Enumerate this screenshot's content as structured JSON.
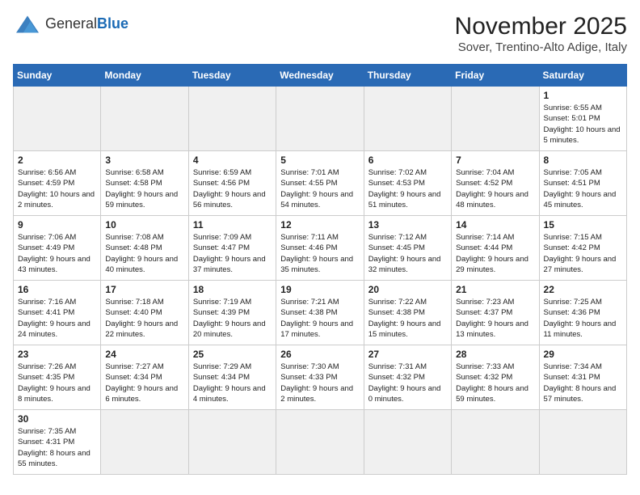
{
  "logo": {
    "text_general": "General",
    "text_blue": "Blue"
  },
  "title": "November 2025",
  "subtitle": "Sover, Trentino-Alto Adige, Italy",
  "days_of_week": [
    "Sunday",
    "Monday",
    "Tuesday",
    "Wednesday",
    "Thursday",
    "Friday",
    "Saturday"
  ],
  "weeks": [
    [
      {
        "day": "",
        "info": "",
        "empty": true
      },
      {
        "day": "",
        "info": "",
        "empty": true
      },
      {
        "day": "",
        "info": "",
        "empty": true
      },
      {
        "day": "",
        "info": "",
        "empty": true
      },
      {
        "day": "",
        "info": "",
        "empty": true
      },
      {
        "day": "",
        "info": "",
        "empty": true
      },
      {
        "day": "1",
        "info": "Sunrise: 6:55 AM\nSunset: 5:01 PM\nDaylight: 10 hours and 5 minutes."
      }
    ],
    [
      {
        "day": "2",
        "info": "Sunrise: 6:56 AM\nSunset: 4:59 PM\nDaylight: 10 hours and 2 minutes."
      },
      {
        "day": "3",
        "info": "Sunrise: 6:58 AM\nSunset: 4:58 PM\nDaylight: 9 hours and 59 minutes."
      },
      {
        "day": "4",
        "info": "Sunrise: 6:59 AM\nSunset: 4:56 PM\nDaylight: 9 hours and 56 minutes."
      },
      {
        "day": "5",
        "info": "Sunrise: 7:01 AM\nSunset: 4:55 PM\nDaylight: 9 hours and 54 minutes."
      },
      {
        "day": "6",
        "info": "Sunrise: 7:02 AM\nSunset: 4:53 PM\nDaylight: 9 hours and 51 minutes."
      },
      {
        "day": "7",
        "info": "Sunrise: 7:04 AM\nSunset: 4:52 PM\nDaylight: 9 hours and 48 minutes."
      },
      {
        "day": "8",
        "info": "Sunrise: 7:05 AM\nSunset: 4:51 PM\nDaylight: 9 hours and 45 minutes."
      }
    ],
    [
      {
        "day": "9",
        "info": "Sunrise: 7:06 AM\nSunset: 4:49 PM\nDaylight: 9 hours and 43 minutes."
      },
      {
        "day": "10",
        "info": "Sunrise: 7:08 AM\nSunset: 4:48 PM\nDaylight: 9 hours and 40 minutes."
      },
      {
        "day": "11",
        "info": "Sunrise: 7:09 AM\nSunset: 4:47 PM\nDaylight: 9 hours and 37 minutes."
      },
      {
        "day": "12",
        "info": "Sunrise: 7:11 AM\nSunset: 4:46 PM\nDaylight: 9 hours and 35 minutes."
      },
      {
        "day": "13",
        "info": "Sunrise: 7:12 AM\nSunset: 4:45 PM\nDaylight: 9 hours and 32 minutes."
      },
      {
        "day": "14",
        "info": "Sunrise: 7:14 AM\nSunset: 4:44 PM\nDaylight: 9 hours and 29 minutes."
      },
      {
        "day": "15",
        "info": "Sunrise: 7:15 AM\nSunset: 4:42 PM\nDaylight: 9 hours and 27 minutes."
      }
    ],
    [
      {
        "day": "16",
        "info": "Sunrise: 7:16 AM\nSunset: 4:41 PM\nDaylight: 9 hours and 24 minutes."
      },
      {
        "day": "17",
        "info": "Sunrise: 7:18 AM\nSunset: 4:40 PM\nDaylight: 9 hours and 22 minutes."
      },
      {
        "day": "18",
        "info": "Sunrise: 7:19 AM\nSunset: 4:39 PM\nDaylight: 9 hours and 20 minutes."
      },
      {
        "day": "19",
        "info": "Sunrise: 7:21 AM\nSunset: 4:38 PM\nDaylight: 9 hours and 17 minutes."
      },
      {
        "day": "20",
        "info": "Sunrise: 7:22 AM\nSunset: 4:38 PM\nDaylight: 9 hours and 15 minutes."
      },
      {
        "day": "21",
        "info": "Sunrise: 7:23 AM\nSunset: 4:37 PM\nDaylight: 9 hours and 13 minutes."
      },
      {
        "day": "22",
        "info": "Sunrise: 7:25 AM\nSunset: 4:36 PM\nDaylight: 9 hours and 11 minutes."
      }
    ],
    [
      {
        "day": "23",
        "info": "Sunrise: 7:26 AM\nSunset: 4:35 PM\nDaylight: 9 hours and 8 minutes."
      },
      {
        "day": "24",
        "info": "Sunrise: 7:27 AM\nSunset: 4:34 PM\nDaylight: 9 hours and 6 minutes."
      },
      {
        "day": "25",
        "info": "Sunrise: 7:29 AM\nSunset: 4:34 PM\nDaylight: 9 hours and 4 minutes."
      },
      {
        "day": "26",
        "info": "Sunrise: 7:30 AM\nSunset: 4:33 PM\nDaylight: 9 hours and 2 minutes."
      },
      {
        "day": "27",
        "info": "Sunrise: 7:31 AM\nSunset: 4:32 PM\nDaylight: 9 hours and 0 minutes."
      },
      {
        "day": "28",
        "info": "Sunrise: 7:33 AM\nSunset: 4:32 PM\nDaylight: 8 hours and 59 minutes."
      },
      {
        "day": "29",
        "info": "Sunrise: 7:34 AM\nSunset: 4:31 PM\nDaylight: 8 hours and 57 minutes."
      }
    ],
    [
      {
        "day": "30",
        "info": "Sunrise: 7:35 AM\nSunset: 4:31 PM\nDaylight: 8 hours and 55 minutes."
      },
      {
        "day": "",
        "info": "",
        "empty": true
      },
      {
        "day": "",
        "info": "",
        "empty": true
      },
      {
        "day": "",
        "info": "",
        "empty": true
      },
      {
        "day": "",
        "info": "",
        "empty": true
      },
      {
        "day": "",
        "info": "",
        "empty": true
      },
      {
        "day": "",
        "info": "",
        "empty": true
      }
    ]
  ]
}
